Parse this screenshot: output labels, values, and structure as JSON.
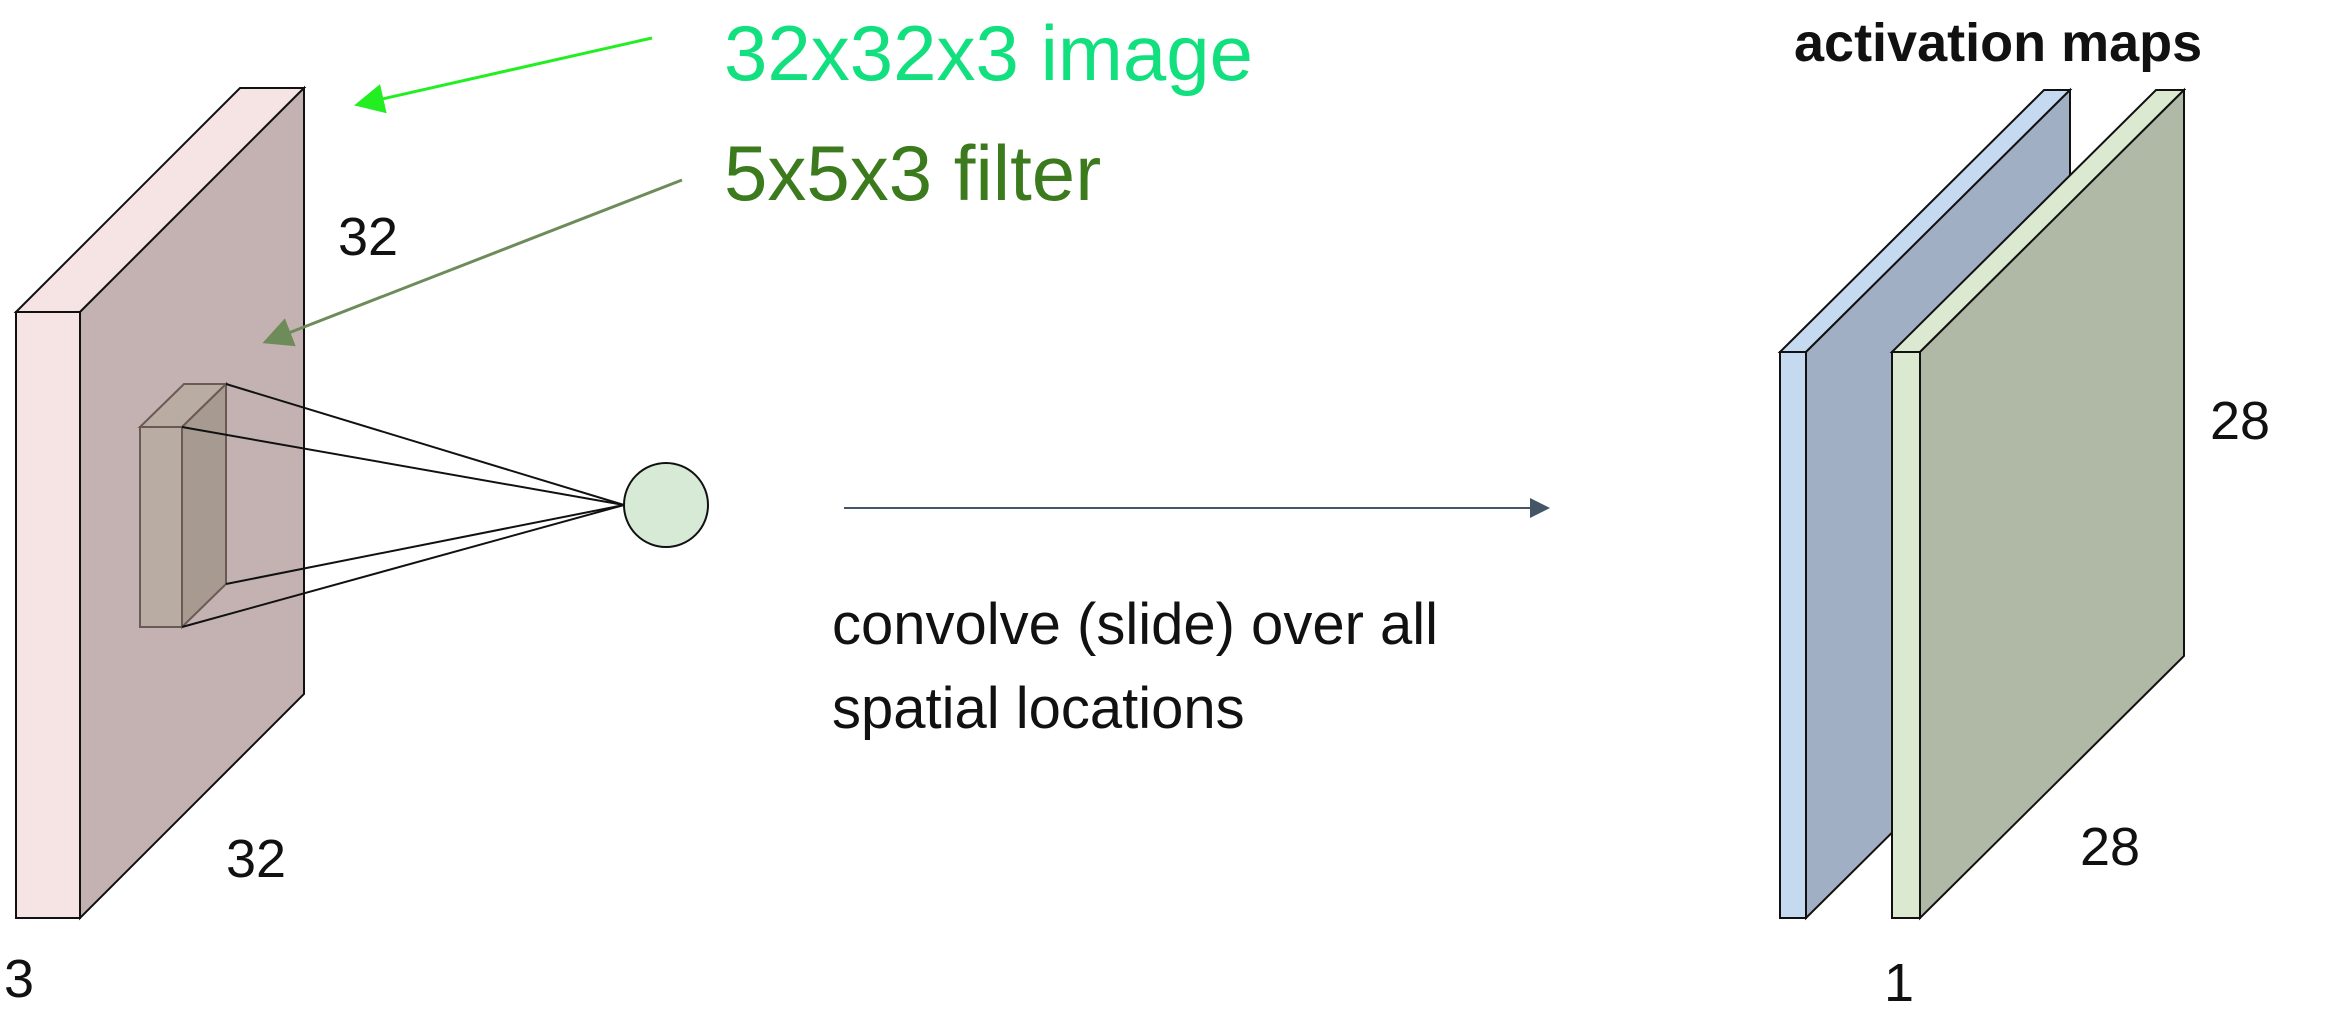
{
  "labels": {
    "image_label": "32x32x3 image",
    "filter_label": "5x5x3 filter",
    "activation_maps": "activation maps",
    "input_height": "32",
    "input_width": "32",
    "input_depth": "3",
    "output_height": "28",
    "output_width": "28",
    "output_depth": "1",
    "convolve_line1": "convolve (slide) over all",
    "convolve_line2": "spatial locations"
  },
  "colors": {
    "image_label": "#12e07f",
    "filter_label": "#3c7a1e",
    "image_arrow": "#22ee22",
    "filter_arrow": "#6e8c5a",
    "input_front": "#c4b2b2",
    "input_side": "#f6e4e4",
    "filter_front": "#a79a90",
    "filter_side": "#b9aca3",
    "neuron_fill": "#d6ead6",
    "map1_front": "#a1afc5",
    "map1_side": "#c5d9f1",
    "map2_front": "#b0b9a6",
    "map2_side": "#dbe9d1",
    "main_arrow": "#445566"
  }
}
